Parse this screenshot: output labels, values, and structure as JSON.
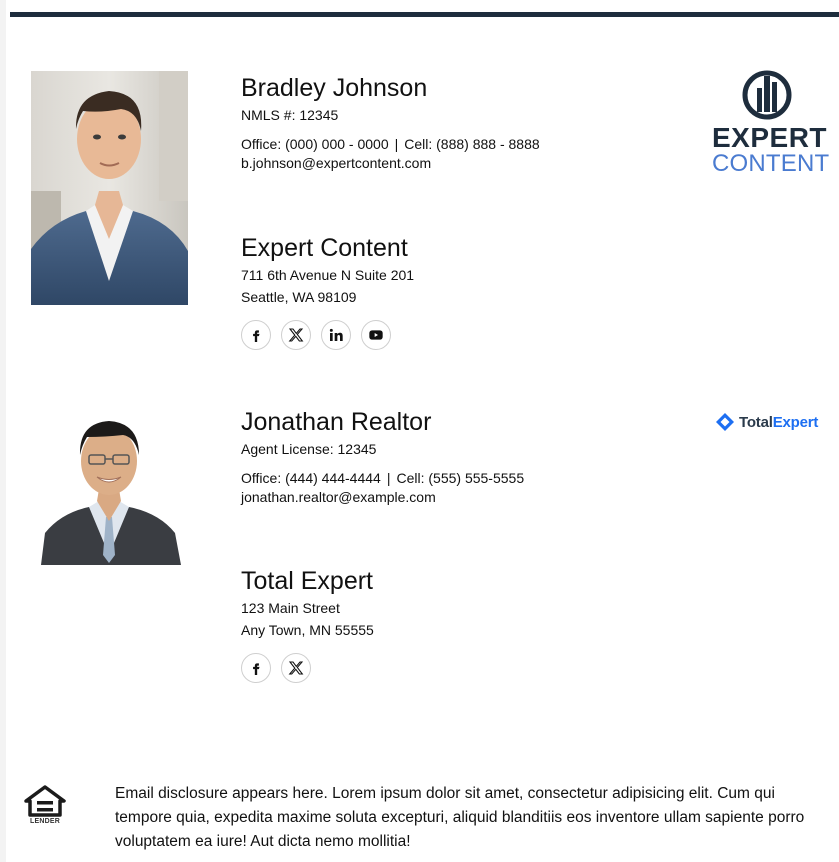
{
  "contacts": [
    {
      "name": "Bradley Johnson",
      "license": "NMLS #: 12345",
      "office": "Office: (000) 000 - 0000",
      "separator": "|",
      "cell": "Cell: (888) 888 - 8888",
      "email": "b.johnson@expertcontent.com",
      "company": "Expert Content",
      "address_line1": "711 6th Avenue N Suite 201",
      "address_line2": "Seattle, WA 98109",
      "socials": [
        "facebook-icon",
        "x-icon",
        "linkedin-icon",
        "youtube-icon"
      ],
      "logo": {
        "line1": "EXPERT",
        "line2": "CONTENT"
      }
    },
    {
      "name": "Jonathan Realtor",
      "license": "Agent License: 12345",
      "office": "Office: (444) 444-4444",
      "separator": "|",
      "cell": "Cell: (555) 555-5555",
      "email": "jonathan.realtor@example.com",
      "company": "Total Expert",
      "address_line1": "123 Main Street",
      "address_line2": "Any Town, MN 55555",
      "socials": [
        "facebook-icon",
        "x-icon"
      ],
      "logo": {
        "part1": "Total",
        "part2": "Expert"
      }
    }
  ],
  "disclosure": {
    "text": "Email disclosure appears here. Lorem ipsum dolor sit amet, consectetur adipisicing elit. Cum qui tempore quia, expedita maxime soluta excepturi, aliquid blanditiis eos inventore ullam sapiente porro voluptatem ea iure! Aut dicta nemo mollitia!",
    "badge_text": "LENDER"
  },
  "colors": {
    "top_rule": "#1e2d3d",
    "brand_navy": "#1e2d3d",
    "brand_blue": "#4a7bd0",
    "total_expert_blue": "#1d6ff2"
  }
}
